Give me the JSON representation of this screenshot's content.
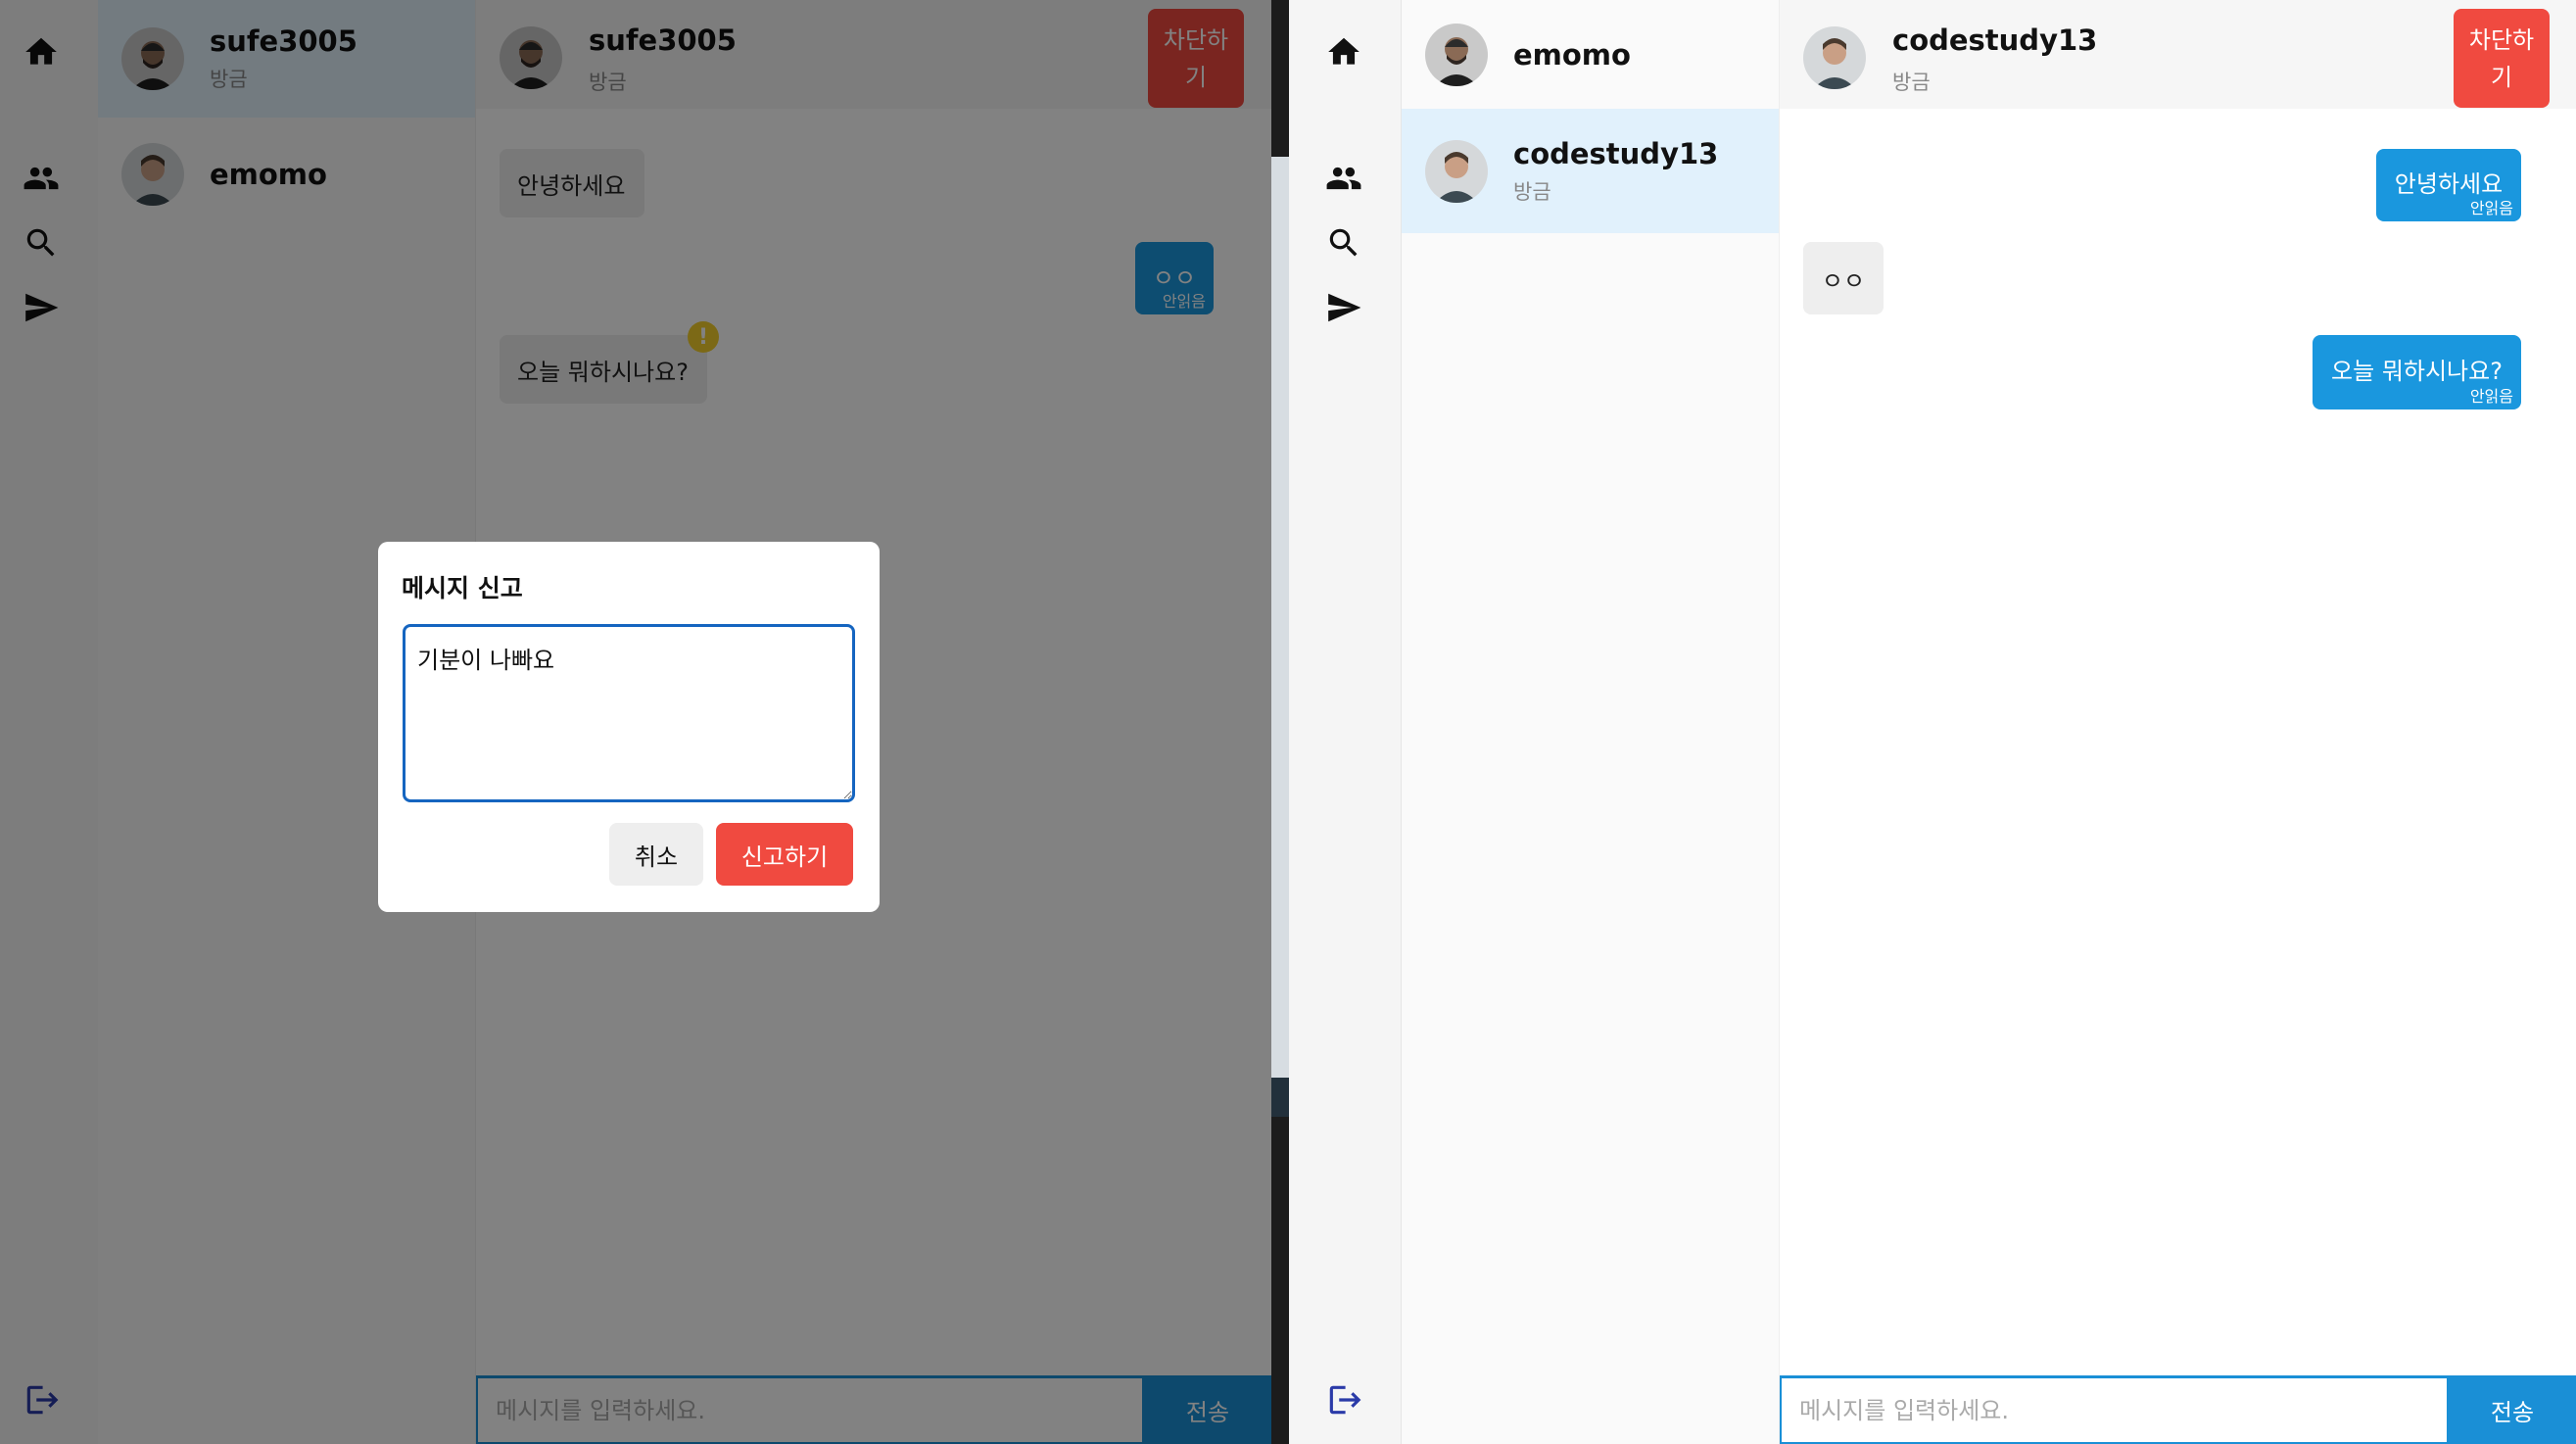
{
  "left": {
    "conversations": [
      {
        "name": "sufe3005",
        "subtitle": "방금",
        "active": true
      },
      {
        "name": "emomo",
        "subtitle": ""
      }
    ],
    "header": {
      "name": "sufe3005",
      "subtitle": "방금",
      "block_label": "차단하기"
    },
    "messages": [
      {
        "text": "안녕하세요",
        "direction": "in"
      },
      {
        "text": "ㅇㅇ",
        "direction": "out",
        "read_label": "안읽음"
      },
      {
        "text": "오늘 뭐하시나요?",
        "direction": "in",
        "warning_badge": "!"
      }
    ],
    "composer": {
      "placeholder": "메시지를 입력하세요.",
      "send_label": "전송"
    },
    "report_modal": {
      "title": "메시지 신고",
      "reason_value": "기분이 나빠요",
      "cancel_label": "취소",
      "submit_label": "신고하기"
    }
  },
  "right": {
    "conversations": [
      {
        "name": "emomo",
        "subtitle": ""
      },
      {
        "name": "codestudy13",
        "subtitle": "방금",
        "active": true
      }
    ],
    "header": {
      "name": "codestudy13",
      "subtitle": "방금",
      "block_label": "차단하기"
    },
    "messages": [
      {
        "text": "안녕하세요",
        "direction": "out",
        "read_label": "안읽음"
      },
      {
        "text": "ㅇㅇ",
        "direction": "in"
      },
      {
        "text": "오늘 뭐하시나요?",
        "direction": "out",
        "read_label": "안읽음"
      }
    ],
    "composer": {
      "placeholder": "메시지를 입력하세요.",
      "send_label": "전송"
    }
  },
  "nav_icons": [
    "home-icon",
    "friends-icon",
    "search-icon",
    "send-icon",
    "logout-icon"
  ],
  "colors": {
    "accent": "#1a97de",
    "danger": "#f04a40",
    "active_item": "#e1f1fc",
    "warning": "#f3cf2b"
  }
}
